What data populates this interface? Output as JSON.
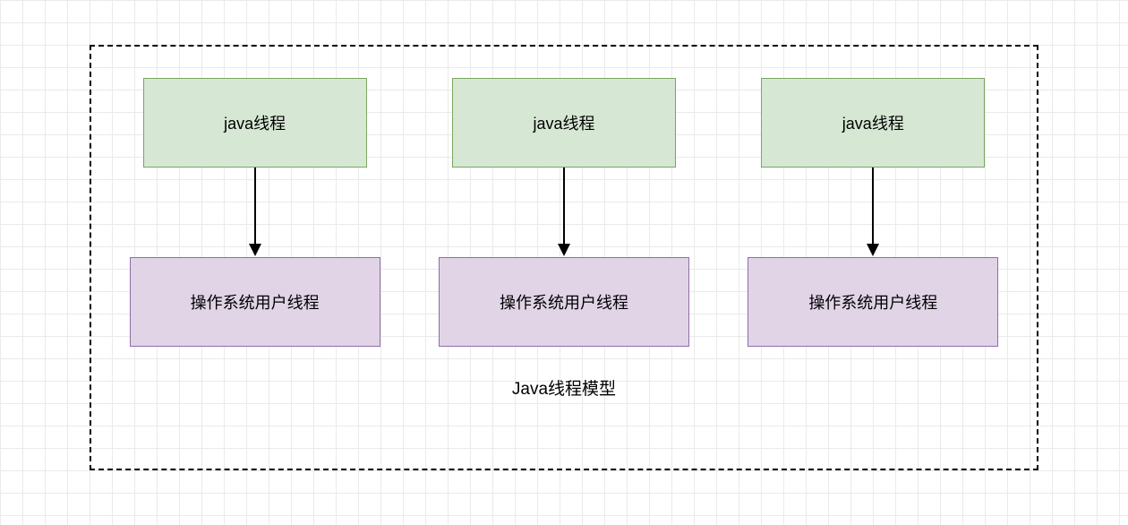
{
  "diagram": {
    "title": "Java线程模型",
    "columns": [
      {
        "top": "java线程",
        "bottom": "操作系统用户线程"
      },
      {
        "top": "java线程",
        "bottom": "操作系统用户线程"
      },
      {
        "top": "java线程",
        "bottom": "操作系统用户线程"
      }
    ]
  }
}
